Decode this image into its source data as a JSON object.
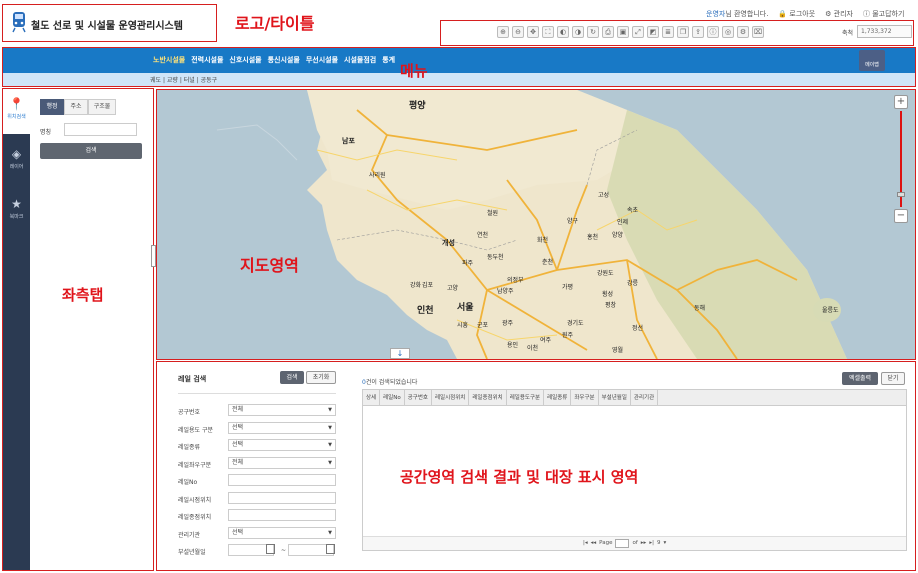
{
  "header": {
    "title": "철도 선로 및 시설물 운영관리시스템",
    "user_name": "운영자",
    "welcome_suffix": "님 환영합니다.",
    "logout": "로그아웃",
    "admin": "관리자",
    "help": "물고답하기",
    "scale_label": "축척",
    "scale_value": "1,733,372",
    "toolbar_icons": [
      "zoom-in-icon",
      "zoom-out-icon",
      "pan-icon",
      "full-extent-icon",
      "prev-extent-icon",
      "next-extent-icon",
      "refresh-icon",
      "print-icon",
      "save-icon",
      "measure-distance-icon",
      "measure-area-icon",
      "layer-icon",
      "copy-icon",
      "export-icon",
      "info-icon",
      "locate-icon",
      "settings-icon",
      "capture-icon"
    ]
  },
  "menu": {
    "items": [
      "노반시설물",
      "전력시설물",
      "신호시설물",
      "통신시설물",
      "무선시설물",
      "시설물점검",
      "통계"
    ],
    "sub_items": "궤도 | 교량 | 터널 | 공동구",
    "my_map": "메이맵"
  },
  "sidebar": {
    "rail": [
      {
        "label": "위치검색",
        "icon": "location-pin-icon"
      },
      {
        "label": "레이어",
        "icon": "layers-icon"
      },
      {
        "label": "북마크",
        "icon": "star-icon"
      }
    ],
    "tabs": [
      "행정",
      "주소",
      "구조물"
    ],
    "name_label": "명칭",
    "search_button": "검색"
  },
  "map": {
    "cities": [
      {
        "name": "평양",
        "cls": "big"
      },
      {
        "name": "남포",
        "cls": ""
      },
      {
        "name": "사리원",
        "cls": "sm"
      },
      {
        "name": "개성",
        "cls": ""
      },
      {
        "name": "파주",
        "cls": "sm"
      },
      {
        "name": "동두천",
        "cls": "sm"
      },
      {
        "name": "의정부",
        "cls": "sm"
      },
      {
        "name": "춘천",
        "cls": "sm"
      },
      {
        "name": "김포",
        "cls": "sm"
      },
      {
        "name": "고양",
        "cls": "sm"
      },
      {
        "name": "남양주",
        "cls": "sm"
      },
      {
        "name": "인천",
        "cls": "big"
      },
      {
        "name": "서울",
        "cls": "big"
      },
      {
        "name": "시흥",
        "cls": "sm"
      },
      {
        "name": "군포",
        "cls": "sm"
      },
      {
        "name": "광주",
        "cls": "sm"
      },
      {
        "name": "여주",
        "cls": "sm"
      },
      {
        "name": "원주",
        "cls": "sm"
      },
      {
        "name": "평창",
        "cls": "sm"
      },
      {
        "name": "강릉",
        "cls": "sm"
      },
      {
        "name": "동해",
        "cls": "sm"
      },
      {
        "name": "정선",
        "cls": "sm"
      },
      {
        "name": "영월",
        "cls": "sm"
      },
      {
        "name": "울릉도",
        "cls": "sm"
      },
      {
        "name": "강원도",
        "cls": "sm"
      },
      {
        "name": "경기도",
        "cls": "sm"
      },
      {
        "name": "용인",
        "cls": "sm"
      },
      {
        "name": "이천",
        "cls": "sm"
      },
      {
        "name": "고성",
        "cls": "sm"
      },
      {
        "name": "속초",
        "cls": "sm"
      },
      {
        "name": "양양",
        "cls": "sm"
      },
      {
        "name": "인제",
        "cls": "sm"
      },
      {
        "name": "홍천",
        "cls": "sm"
      },
      {
        "name": "횡성",
        "cls": "sm"
      },
      {
        "name": "가평",
        "cls": "sm"
      },
      {
        "name": "화천",
        "cls": "sm"
      },
      {
        "name": "양구",
        "cls": "sm"
      },
      {
        "name": "철원",
        "cls": "sm"
      },
      {
        "name": "연천",
        "cls": "sm"
      },
      {
        "name": "강화",
        "cls": "sm"
      }
    ]
  },
  "search_panel": {
    "title": "레일 검색",
    "search": "검색",
    "reset": "초기화",
    "fields": [
      {
        "label": "공구번호",
        "value": "전체",
        "type": "select"
      },
      {
        "label": "레일용도 구분",
        "value": "선택",
        "type": "select"
      },
      {
        "label": "레일종류",
        "value": "선택",
        "type": "select"
      },
      {
        "label": "레일좌우구분",
        "value": "전체",
        "type": "select"
      },
      {
        "label": "레일No",
        "value": "",
        "type": "text"
      },
      {
        "label": "레일시점위치",
        "value": "",
        "type": "text"
      },
      {
        "label": "레일종점위치",
        "value": "",
        "type": "text"
      },
      {
        "label": "관리기관",
        "value": "선택",
        "type": "select"
      },
      {
        "label": "부설년월일",
        "value": "",
        "type": "date"
      }
    ],
    "date_sep": "~"
  },
  "results": {
    "count": "0",
    "count_suffix": "건이 검색되었습니다",
    "excel": "엑셀출력",
    "close": "닫기",
    "columns": [
      "상세",
      "레일No",
      "공구번호",
      "레일시점위치",
      "레일종점위치",
      "레일용도구분",
      "레일종류",
      "좌우구분",
      "부설년월일",
      "관리기관"
    ],
    "pager": {
      "page_label": "Page",
      "of_label": "of",
      "per_page": "9"
    }
  },
  "annotations": {
    "logo": "로고/타이틀",
    "menu": "메뉴",
    "left": "좌측탭",
    "map": "지도영역",
    "bottom": "공간영역 검색 결과 및 대장 표시 영역"
  },
  "colors": {
    "annotation": "#e0141b",
    "menu_bg": "#1879c6",
    "rail_bg": "#2b3a52"
  }
}
